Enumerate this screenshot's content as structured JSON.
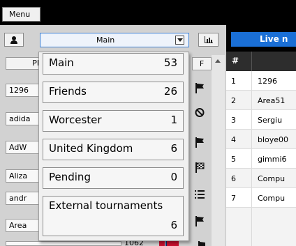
{
  "menu": {
    "label": "Menu"
  },
  "group_select": {
    "selected": "Main"
  },
  "player_list": {
    "header_label": "Pl",
    "f_header": "F",
    "rows": [
      {
        "name": "1296",
        "status_icon": "flag-icon"
      },
      {
        "name": "adida",
        "status_icon": "no-entry-icon"
      },
      {
        "name": "AdW",
        "status_icon": "flag-icon"
      },
      {
        "name": "Aliza",
        "status_icon": "checkered-flag-icon"
      },
      {
        "name": "andr",
        "status_icon": "list-icon"
      },
      {
        "name": "Area",
        "status_icon": "flag-icon"
      }
    ],
    "bottom_partial_rating": "1062"
  },
  "group_popup": {
    "options": [
      {
        "label": "Main",
        "count": "53"
      },
      {
        "label": "Friends",
        "count": "26"
      },
      {
        "label": "Worcester",
        "count": "1"
      },
      {
        "label": "United Kingdom",
        "count": "6"
      },
      {
        "label": "Pending",
        "count": "0"
      },
      {
        "label": "External tournaments",
        "count": "6"
      }
    ]
  },
  "live": {
    "header": "Live n",
    "col_rank": "#",
    "rows": [
      {
        "rank": "1",
        "name": "1296"
      },
      {
        "rank": "2",
        "name": "Area51"
      },
      {
        "rank": "3",
        "name": "Sergiu"
      },
      {
        "rank": "4",
        "name": "bloye00"
      },
      {
        "rank": "5",
        "name": "gimmi6"
      },
      {
        "rank": "6",
        "name": "Compu"
      },
      {
        "rank": "7",
        "name": "Compu"
      }
    ]
  },
  "colors": {
    "live_header_bg": "#1a6fd6",
    "select_border": "#3c7fd2",
    "panel_bg": "#d2d2d2",
    "table_header_bg": "#2d2d2d"
  }
}
